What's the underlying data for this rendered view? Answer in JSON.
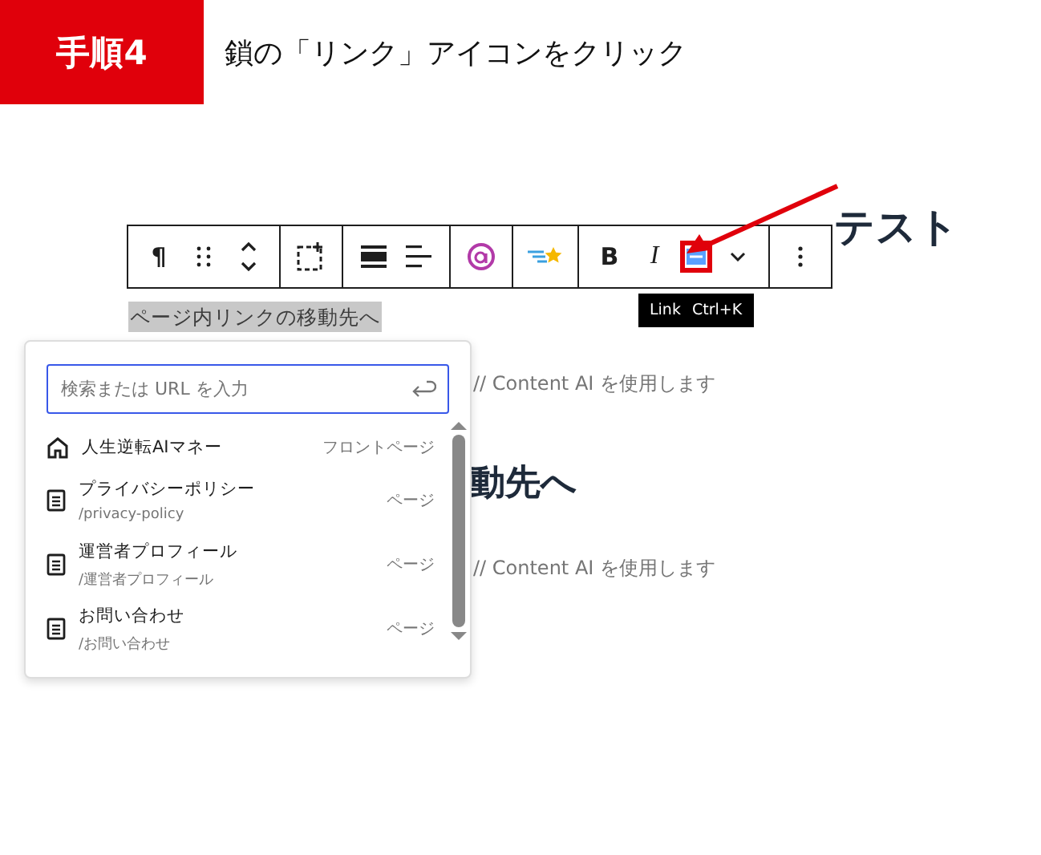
{
  "step": {
    "badge": "手順4",
    "title": "鎖の「リンク」アイコンをクリック"
  },
  "editor": {
    "heading": "テスト",
    "selected_text": "ページ内リンクの移動先へ",
    "blocks": [
      {
        "kind": "hint",
        "text": "// Content AI を使用します"
      },
      {
        "kind": "heading",
        "text": "動先へ"
      },
      {
        "kind": "hint",
        "text": "// Content AI を使用します"
      }
    ]
  },
  "toolbar": {
    "groups": [
      [
        {
          "kind": "glyph",
          "label": "¶"
        },
        {
          "kind": "drag"
        },
        {
          "kind": "move"
        }
      ],
      [
        {
          "kind": "select-parent"
        }
      ],
      [
        {
          "kind": "align"
        },
        {
          "kind": "text-align"
        }
      ],
      [
        {
          "kind": "ai"
        }
      ],
      [
        {
          "kind": "star"
        }
      ],
      [
        {
          "kind": "glyph",
          "label": "B"
        },
        {
          "kind": "italic",
          "label": "I"
        },
        {
          "kind": "link",
          "highlighted": true
        },
        {
          "kind": "more"
        }
      ],
      [
        {
          "kind": "options"
        }
      ]
    ]
  },
  "tooltip": {
    "label": "Link",
    "shortcut": "Ctrl+K"
  },
  "link_popover": {
    "search": {
      "placeholder": "検索または URL を入力"
    },
    "results": [
      {
        "kind": "home",
        "title": "人生逆転AIマネー",
        "type": "フロントページ"
      },
      {
        "kind": "page",
        "title": "プライバシーポリシー",
        "url": "/privacy-policy",
        "type": "ページ"
      },
      {
        "kind": "page",
        "title": "運営者プロフィール",
        "url": "/運営者プロフィール",
        "type": "ページ"
      },
      {
        "kind": "page",
        "title": "お問い合わせ",
        "url": "/お問い合わせ",
        "type": "ページ"
      }
    ]
  }
}
